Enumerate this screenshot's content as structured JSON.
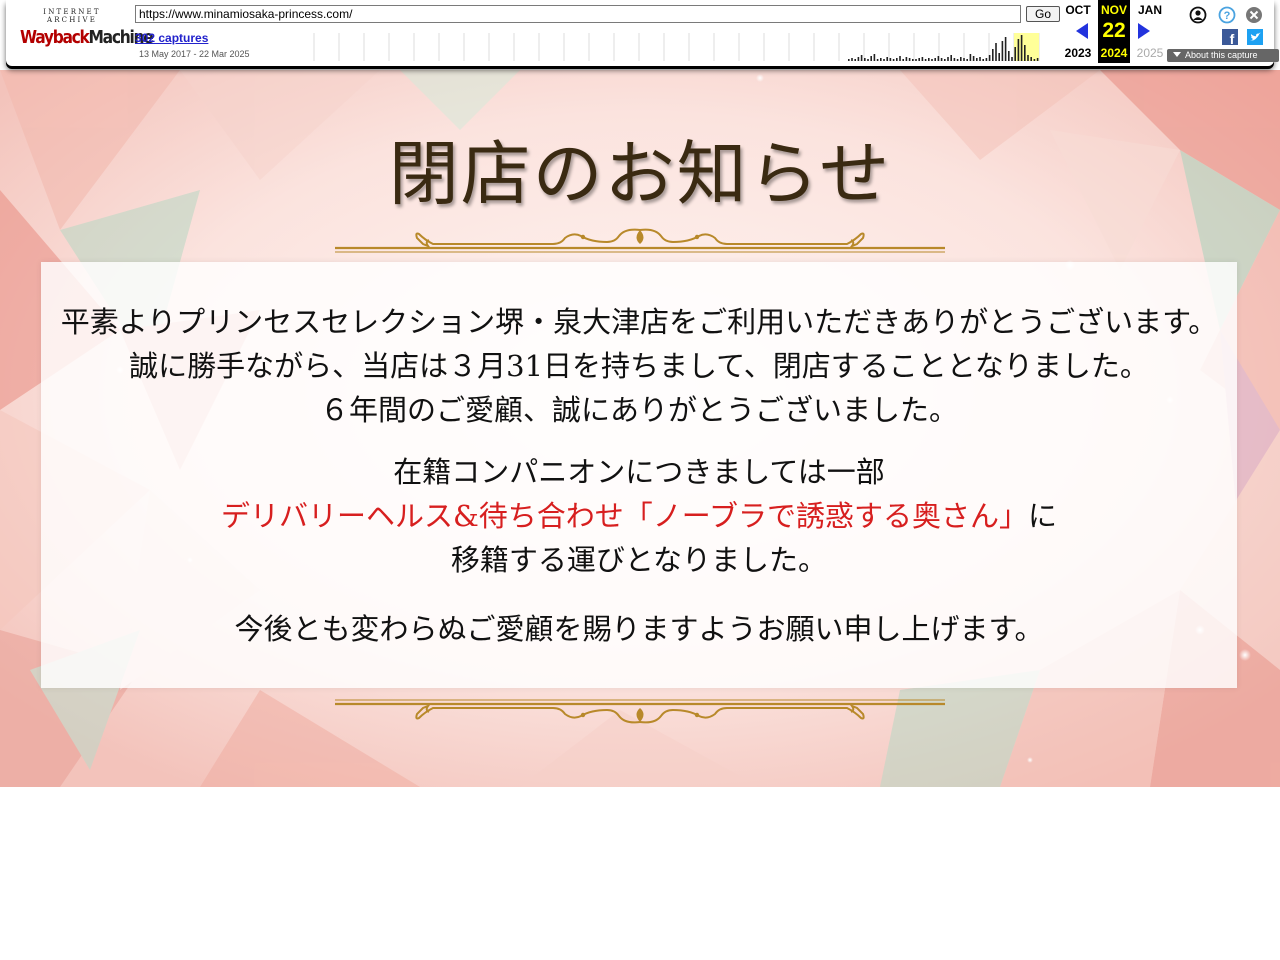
{
  "wayback": {
    "logo_top": "INTERNET ARCHIVE",
    "logo_word1": "Wayback",
    "logo_word2": "Machine",
    "url": "https://www.minamiosaka-princess.com/",
    "go_label": "Go",
    "captures": "302 captures",
    "date_range": "13 May 2017 - 22 Mar 2025",
    "prev_month": "OCT",
    "current_month": "NOV",
    "next_month": "JAN",
    "current_day": "22",
    "prev_year": "2023",
    "current_year": "2024",
    "next_year": "2025",
    "about_label": "About this capture",
    "icons": [
      "user-icon",
      "help-icon",
      "close-icon",
      "facebook-icon",
      "twitter-icon"
    ],
    "colors": {
      "highlight": "#ffff00",
      "nav_arrow": "#2233dd",
      "logo_red": "#b30000"
    }
  },
  "notice": {
    "title": "閉店のお知らせ",
    "para1": [
      "平素よりプリンセスセレクション堺・泉大津店をご利用いただきありがとうございます。",
      "誠に勝手ながら、当店は３月31日を持ちまして、閉店することとなりました。",
      "６年間のご愛顧、誠にありがとうございました。"
    ],
    "para2_line1": "在籍コンパニオンにつきましては一部",
    "para2_highlight": "デリバリーヘルス&待ち合わせ「ノーブラで誘惑する奥さん」",
    "para2_line2_suffix": "に",
    "para2_line3": "移籍する運びとなりました。",
    "para3": "今後とも変わらぬご愛顧を賜りますようお願い申し上げます。",
    "colors": {
      "title": "#3a2a12",
      "highlight": "#d71f1f",
      "ornament": "#b8892a"
    }
  }
}
